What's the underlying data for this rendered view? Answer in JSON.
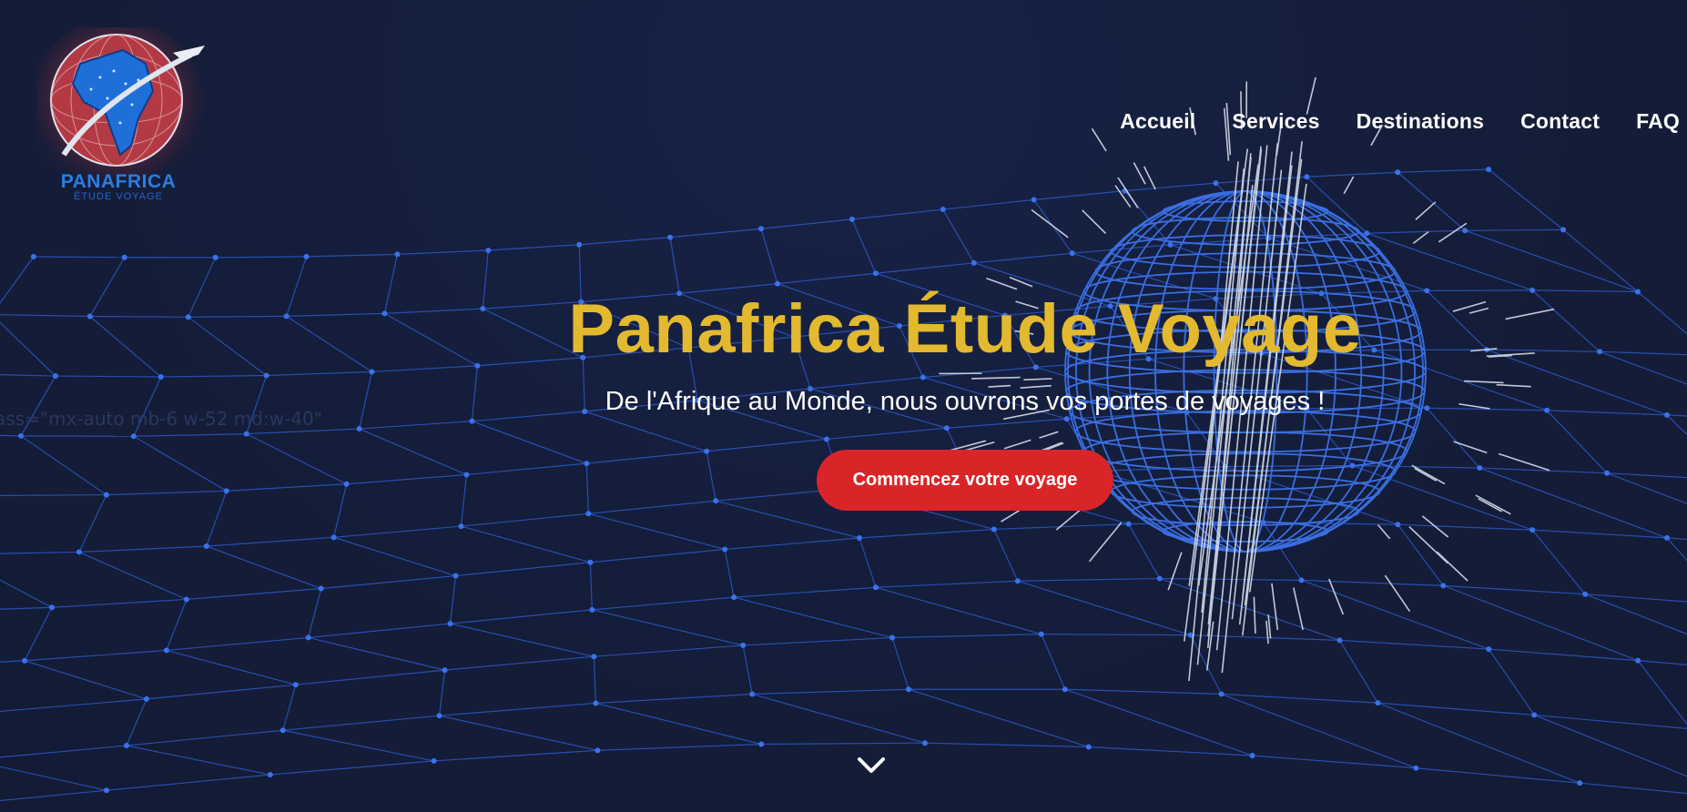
{
  "nav": {
    "items": [
      {
        "label": "Accueil"
      },
      {
        "label": "Services"
      },
      {
        "label": "Destinations"
      },
      {
        "label": "Contact"
      },
      {
        "label": "FAQ"
      }
    ]
  },
  "logo": {
    "name": "PANAFRICA",
    "tagline": "ÉTUDE VOYAGE",
    "icon": "globe-airplane-logo"
  },
  "stray_text": "ass=\"mx-auto mb-6 w-52 md:w-40\"",
  "hero": {
    "title": "Panafrica Étude Voyage",
    "subtitle": "De l'Afrique au Monde, nous ouvrons vos portes de voyages !",
    "cta_label": "Commencez votre voyage"
  },
  "scroll_icon": "chevron-down-icon",
  "colors": {
    "background": "#141d39",
    "title": "#e3b92f",
    "cta": "#d92528",
    "mesh": "#2f5fd6"
  }
}
